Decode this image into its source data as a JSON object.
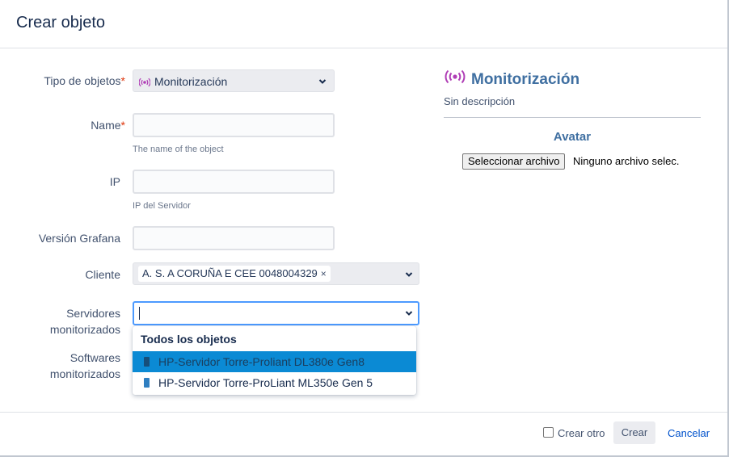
{
  "dialog": {
    "title": "Crear objeto"
  },
  "form": {
    "tipo": {
      "label": "Tipo de objetos",
      "required_mark": "*",
      "value": "Monitorización",
      "icon": "broadcast-icon"
    },
    "name": {
      "label": "Name",
      "required_mark": "*",
      "value": "",
      "help": "The name of the object"
    },
    "ip": {
      "label": "IP",
      "value": "",
      "help": "IP del Servidor"
    },
    "version": {
      "label": "Versión Grafana",
      "value": ""
    },
    "cliente": {
      "label": "Cliente",
      "tag": "A. S. A CORUÑA E CEE 0048004329",
      "tag_remove": "×"
    },
    "servidores": {
      "label_line1": "Servidores",
      "label_line2": "monitorizados",
      "value": ""
    },
    "softwares": {
      "label_line1": "Softwares",
      "label_line2": "monitorizados"
    }
  },
  "dropdown": {
    "heading": "Todos los objetos",
    "items": [
      {
        "label": "HP-Servidor Torre-Proliant DL380e Gen8",
        "selected": true,
        "icon": "server-icon"
      },
      {
        "label": "HP-Servidor Torre-ProLiant ML350e Gen 5",
        "selected": false,
        "icon": "server-icon"
      }
    ]
  },
  "side_panel": {
    "title": "Monitorización",
    "description": "Sin descripción",
    "avatar_label": "Avatar",
    "file_button": "Seleccionar archivo",
    "file_status": "Ninguno archivo selec."
  },
  "footer": {
    "create_another": "Crear otro",
    "create_button": "Crear",
    "cancel_link": "Cancelar"
  },
  "colors": {
    "accent": "#3f6fa1",
    "icon_purple": "#b03fb6",
    "selection": "#0b8ad4",
    "link": "#0052cc"
  }
}
